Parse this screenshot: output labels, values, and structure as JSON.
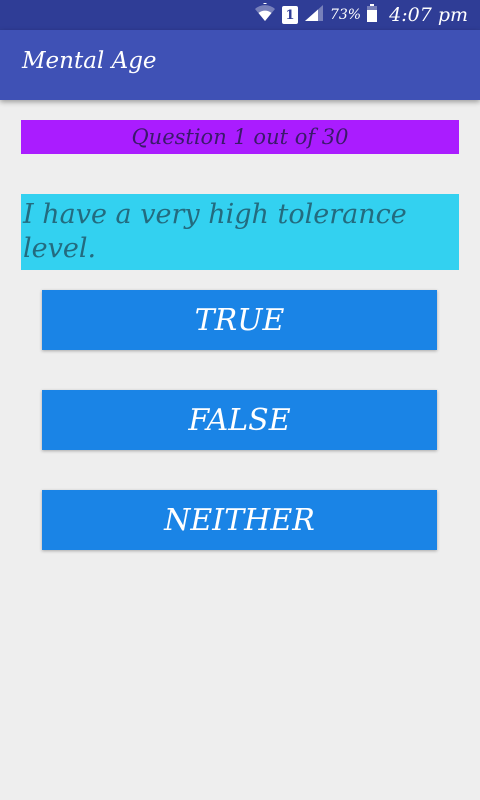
{
  "status_bar": {
    "sim_label": "1",
    "battery": "73%",
    "time": "4:07 pm",
    "icons": [
      "wifi-icon",
      "sim-icon",
      "signal-icon",
      "battery-icon"
    ]
  },
  "app_bar": {
    "title": "Mental Age"
  },
  "quiz": {
    "counter": "Question 1 out of 30",
    "question": "I have a very high tolerance level.",
    "answers": [
      "TRUE",
      "FALSE",
      "NEITHER"
    ]
  },
  "colors": {
    "status_bar": "#2f3d96",
    "app_bar": "#3f51b5",
    "counter_bg": "#aa1cff",
    "question_bg": "#33d1f0",
    "button_bg": "#1a84e6",
    "background": "#eeeeee"
  }
}
